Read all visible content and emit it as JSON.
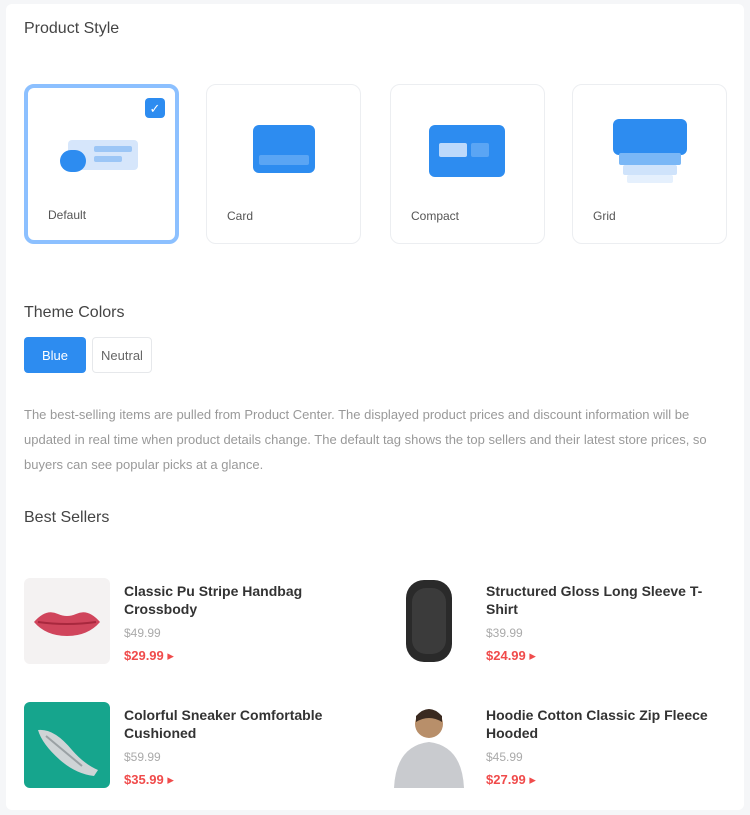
{
  "sections": {
    "display_style": "Product Style",
    "theme": "Theme Colors",
    "best_sellers": "Best Sellers"
  },
  "styles": [
    {
      "label": "Default",
      "selected": true
    },
    {
      "label": "Card",
      "selected": false
    },
    {
      "label": "Compact",
      "selected": false
    },
    {
      "label": "Grid",
      "selected": false
    }
  ],
  "theme_toggle": {
    "active": "Blue",
    "inactive": "Neutral"
  },
  "description": "The best-selling items are pulled from Product Center. The displayed product prices and discount information will be updated in real time when product details change. The default tag shows the top sellers and their latest store prices, so buyers can see popular picks at a glance.",
  "products": [
    {
      "title": "Classic Pu Stripe Handbag Crossbody",
      "orig": "$49.99",
      "price": "$29.99 ▸",
      "thumb": "lips-icon"
    },
    {
      "title": "Structured Gloss Long Sleeve T-Shirt",
      "orig": "$39.99",
      "price": "$24.99 ▸",
      "thumb": "phone-case-icon"
    },
    {
      "title": "Colorful Sneaker Comfortable Cushioned",
      "orig": "$59.99",
      "price": "$35.99 ▸",
      "thumb": "shoe-icon"
    },
    {
      "title": "Hoodie Cotton Classic Zip Fleece Hooded",
      "orig": "$45.99",
      "price": "$27.99 ▸",
      "thumb": "hoodie-person-icon"
    }
  ],
  "colors": {
    "accent": "#2d8cf0",
    "selected_border": "#8cc0ff",
    "price": "#f04b4b"
  }
}
